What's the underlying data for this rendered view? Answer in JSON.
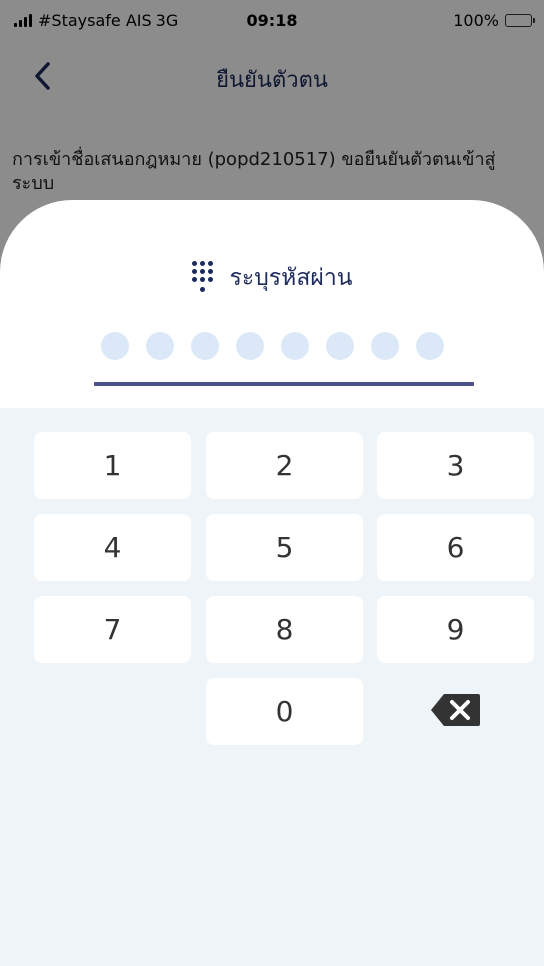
{
  "status_bar": {
    "carrier": "#Staysafe AIS",
    "network": "3G",
    "time": "09:18",
    "battery": "100%",
    "battery_color": "#f5c400"
  },
  "nav": {
    "back_icon": "chevron-left-icon",
    "title": "ยืนยันตัวตน"
  },
  "message": {
    "text": "การเข้าชื่อเสนอกฎหมาย (popd210517) ขอยืนยันตัวตนเข้าสู่ระบบ"
  },
  "pin_sheet": {
    "icon": "keypad-icon",
    "title": "ระบุรหัสผ่าน",
    "pin_length": 8,
    "entered_digits": 0
  },
  "keypad": {
    "keys": [
      "1",
      "2",
      "3",
      "4",
      "5",
      "6",
      "7",
      "8",
      "9",
      "0"
    ],
    "backspace_icon": "backspace-icon"
  },
  "colors": {
    "accent": "#1d2a5c",
    "pin_dot_empty": "#dbe8f7",
    "underline": "#4a5088",
    "keypad_bg": "#eef4f8"
  }
}
